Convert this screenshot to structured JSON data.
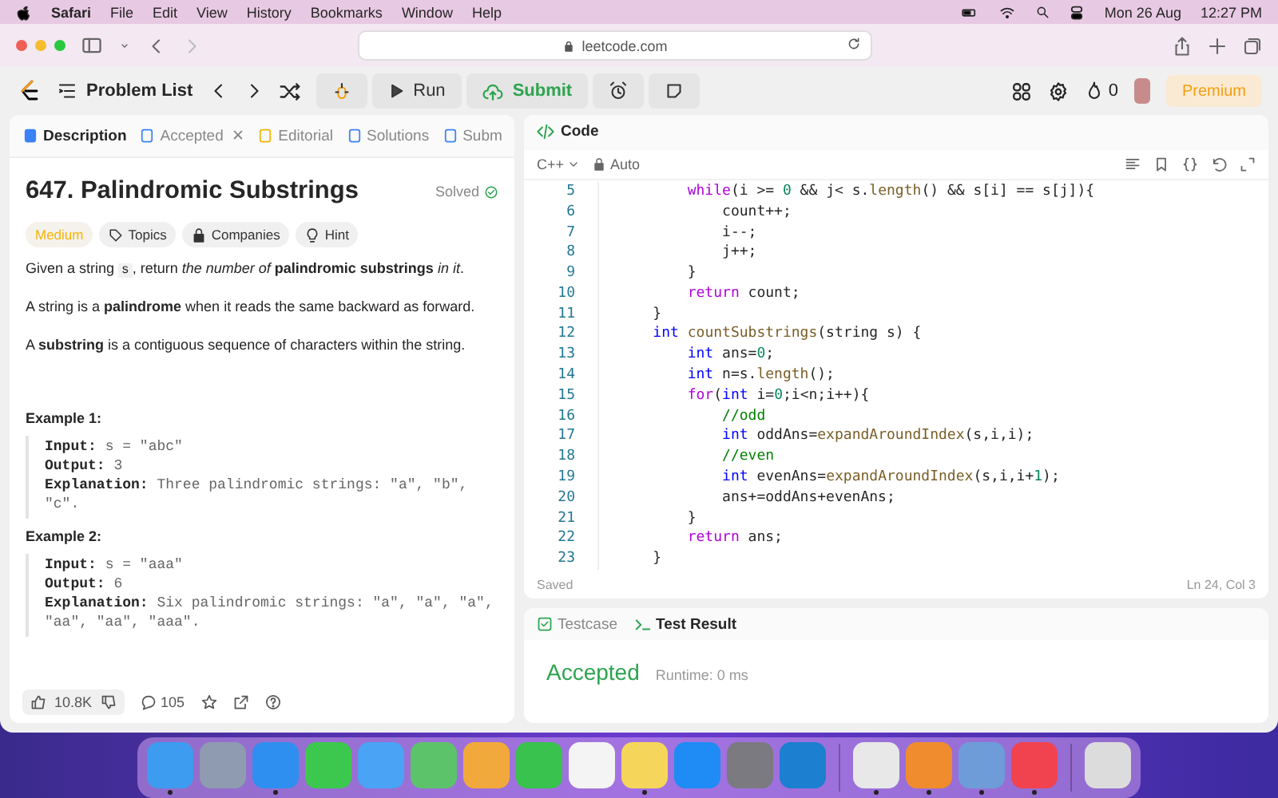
{
  "menu_bar": {
    "app": "Safari",
    "items": [
      "File",
      "Edit",
      "View",
      "History",
      "Bookmarks",
      "Window",
      "Help"
    ],
    "date": "Mon 26 Aug",
    "time": "12:27 PM"
  },
  "browser": {
    "url": "leetcode.com"
  },
  "header": {
    "problem_list": "Problem List",
    "run": "Run",
    "submit": "Submit",
    "streak": "0",
    "premium": "Premium"
  },
  "left_tabs": [
    {
      "label": "Description",
      "selected": true,
      "closable": false
    },
    {
      "label": "Accepted",
      "selected": false,
      "closable": true
    },
    {
      "label": "Editorial",
      "selected": false,
      "closable": false
    },
    {
      "label": "Solutions",
      "selected": false,
      "closable": false
    },
    {
      "label": "Subm",
      "selected": false,
      "closable": false
    }
  ],
  "close_tab": "✕",
  "problem": {
    "title": "647. Palindromic Substrings",
    "status": "Solved",
    "tags": [
      {
        "kind": "difficulty",
        "label": "Medium"
      },
      {
        "kind": "topics",
        "label": "Topics"
      },
      {
        "kind": "companies",
        "label": "Companies"
      },
      {
        "kind": "hint",
        "label": "Hint"
      }
    ],
    "intro": {
      "before": "Given a string ",
      "code": "s",
      "after": ", return *the number of* **palindromic substrings** *in it*."
    },
    "paragraphs": [
      "A string is a **palindrome** when it reads the same backward as forward.",
      "A **substring** is a contiguous sequence of characters within the string."
    ],
    "examples": [
      {
        "title": "Example 1:",
        "lines": [
          {
            "label": "Input:",
            "value": "s = \"abc\""
          },
          {
            "label": "Output:",
            "value": "3"
          },
          {
            "label": "Explanation:",
            "value": "Three palindromic strings: \"a\", \"b\", \"c\"."
          }
        ]
      },
      {
        "title": "Example 2:",
        "lines": [
          {
            "label": "Input:",
            "value": "s = \"aaa\""
          },
          {
            "label": "Output:",
            "value": "6"
          },
          {
            "label": "Explanation:",
            "value": "Six palindromic strings: \"a\", \"a\", \"a\", \"aa\", \"aa\", \"aaa\"."
          }
        ]
      }
    ]
  },
  "footer": {
    "likes": "10.8K",
    "comments": "105"
  },
  "code_panel": {
    "title": "Code",
    "language": "C++",
    "mode": "Auto",
    "status": "Saved",
    "cursor": "Ln 24, Col 3",
    "lines": [
      {
        "number": "5",
        "tokens": [
          {
            "kind": "kw",
            "text": "        while"
          },
          {
            "kind": "plain",
            "text": "(i >= "
          },
          {
            "kind": "num",
            "text": "0"
          },
          {
            "kind": "plain",
            "text": " && j< s."
          },
          {
            "kind": "fn",
            "text": "length"
          },
          {
            "kind": "plain",
            "text": "() && s[i] == s[j]){"
          }
        ]
      },
      {
        "number": "6",
        "tokens": [
          {
            "kind": "plain",
            "text": "            count++;"
          }
        ]
      },
      {
        "number": "7",
        "tokens": [
          {
            "kind": "plain",
            "text": "            i--;"
          }
        ]
      },
      {
        "number": "8",
        "tokens": [
          {
            "kind": "plain",
            "text": "            j++;"
          }
        ]
      },
      {
        "number": "9",
        "tokens": [
          {
            "kind": "plain",
            "text": "        }"
          }
        ]
      },
      {
        "number": "10",
        "tokens": [
          {
            "kind": "kw",
            "text": "        return"
          },
          {
            "kind": "plain",
            "text": " count;"
          }
        ]
      },
      {
        "number": "11",
        "tokens": [
          {
            "kind": "plain",
            "text": "    }"
          }
        ]
      },
      {
        "number": "12",
        "tokens": [
          {
            "kind": "type",
            "text": "    int"
          },
          {
            "kind": "fn",
            "text": " countSubstrings"
          },
          {
            "kind": "plain",
            "text": "(string s) {"
          }
        ]
      },
      {
        "number": "13",
        "tokens": [
          {
            "kind": "type",
            "text": "        int"
          },
          {
            "kind": "plain",
            "text": " ans="
          },
          {
            "kind": "num",
            "text": "0"
          },
          {
            "kind": "plain",
            "text": ";"
          }
        ]
      },
      {
        "number": "14",
        "tokens": [
          {
            "kind": "type",
            "text": "        int"
          },
          {
            "kind": "plain",
            "text": " n=s."
          },
          {
            "kind": "fn",
            "text": "length"
          },
          {
            "kind": "plain",
            "text": "();"
          }
        ]
      },
      {
        "number": "15",
        "tokens": [
          {
            "kind": "kw",
            "text": "        for"
          },
          {
            "kind": "plain",
            "text": "("
          },
          {
            "kind": "type",
            "text": "int"
          },
          {
            "kind": "plain",
            "text": " i="
          },
          {
            "kind": "num",
            "text": "0"
          },
          {
            "kind": "plain",
            "text": ";i<n;i++){"
          }
        ]
      },
      {
        "number": "16",
        "tokens": [
          {
            "kind": "comment",
            "text": "            //odd"
          }
        ]
      },
      {
        "number": "17",
        "tokens": [
          {
            "kind": "type",
            "text": "            int"
          },
          {
            "kind": "plain",
            "text": " oddAns="
          },
          {
            "kind": "fn",
            "text": "expandAroundIndex"
          },
          {
            "kind": "plain",
            "text": "(s,i,i);"
          }
        ]
      },
      {
        "number": "18",
        "tokens": [
          {
            "kind": "comment",
            "text": "            //even"
          }
        ]
      },
      {
        "number": "19",
        "tokens": [
          {
            "kind": "type",
            "text": "            int"
          },
          {
            "kind": "plain",
            "text": " evenAns="
          },
          {
            "kind": "fn",
            "text": "expandAroundIndex"
          },
          {
            "kind": "plain",
            "text": "(s,i,i+"
          },
          {
            "kind": "num",
            "text": "1"
          },
          {
            "kind": "plain",
            "text": ");"
          }
        ]
      },
      {
        "number": "20",
        "tokens": [
          {
            "kind": "plain",
            "text": "            ans+=oddAns+evenAns;"
          }
        ]
      },
      {
        "number": "21",
        "tokens": [
          {
            "kind": "plain",
            "text": "        }"
          }
        ]
      },
      {
        "number": "22",
        "tokens": [
          {
            "kind": "kw",
            "text": "        return"
          },
          {
            "kind": "plain",
            "text": " ans;"
          }
        ]
      },
      {
        "number": "23",
        "tokens": [
          {
            "kind": "plain",
            "text": "    }"
          }
        ]
      }
    ]
  },
  "result_tabs": [
    {
      "label": "Testcase",
      "selected": false
    },
    {
      "label": "Test Result",
      "selected": true
    }
  ],
  "result": {
    "verdict": "Accepted",
    "runtime": "Runtime: 0 ms"
  },
  "dock": {
    "groups": [
      {
        "apps": [
          {
            "color": "#3d9cf0",
            "running": true
          },
          {
            "color": "#8e9bb0",
            "running": false
          },
          {
            "color": "#2f8ff0",
            "running": true
          },
          {
            "color": "#3cc84e",
            "running": false
          },
          {
            "color": "#4aa3f5",
            "running": false
          },
          {
            "color": "#5cc36a",
            "running": false
          },
          {
            "color": "#f2a93b",
            "running": false
          },
          {
            "color": "#39c24e",
            "running": false
          },
          {
            "color": "#f4f4f4",
            "running": false
          },
          {
            "color": "#f6d65a",
            "running": true
          },
          {
            "color": "#1e8cf4",
            "running": false
          },
          {
            "color": "#7a7a80",
            "running": false
          },
          {
            "color": "#1d7fd0",
            "running": false
          }
        ]
      },
      {
        "apps": [
          {
            "color": "#e8e8e8",
            "running": true
          },
          {
            "color": "#f08c2e",
            "running": true
          },
          {
            "color": "#6e9cd8",
            "running": true
          },
          {
            "color": "#f0434f",
            "running": true
          }
        ]
      },
      {
        "apps": [
          {
            "color": "#dcdcdc",
            "running": false
          }
        ]
      }
    ]
  }
}
